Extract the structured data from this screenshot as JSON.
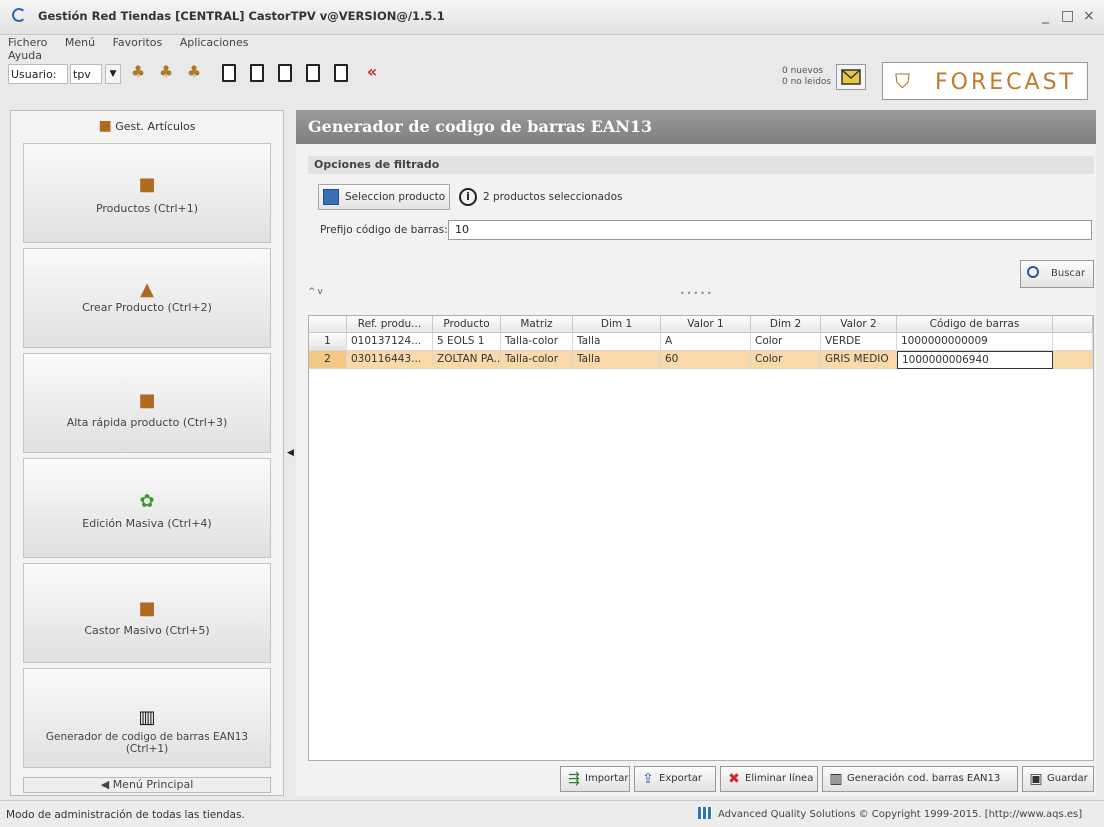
{
  "window": {
    "title": "Gestión Red Tiendas [CENTRAL] CastorTPV v@VERSION@/1.5.1",
    "controls": [
      "_",
      "□",
      "×"
    ]
  },
  "menubar": [
    "Fichero",
    "Menú",
    "Favoritos",
    "Aplicaciones",
    "Ayuda"
  ],
  "toolbar": {
    "user_label": "Usuario:",
    "user_value": "tpv",
    "messages_new": "0 nuevos",
    "messages_unread": "0 no leidos",
    "brand": "FORECAST"
  },
  "left_panel": {
    "title": "Gest. Artículos",
    "buttons": [
      {
        "label": "Productos (Ctrl+1)",
        "icon": "box-icon"
      },
      {
        "label": "Crear Producto (Ctrl+2)",
        "icon": "create-product-icon"
      },
      {
        "label": "Alta rápida producto (Ctrl+3)",
        "icon": "box-icon"
      },
      {
        "label": "Edición Masiva (Ctrl+4)",
        "icon": "gear-icon"
      },
      {
        "label": "Castor Masivo (Ctrl+5)",
        "icon": "box-icon"
      },
      {
        "label": "Generador de codigo de barras EAN13 (Ctrl+1)",
        "icon": "barcode-icon"
      }
    ],
    "main_menu": "◀ Menú Principal"
  },
  "main": {
    "header": "Generador de codigo de barras EAN13",
    "filter_section": "Opciones de filtrado",
    "select_product_button": "Seleccion producto",
    "selected_info": "2 productos seleccionados",
    "prefix_label": "Prefijo código de barras:",
    "prefix_value": "10",
    "search_button": "Buscar",
    "table": {
      "columns": [
        "Ref. produ...",
        "Producto",
        "Matriz",
        "Dim 1",
        "Valor 1",
        "Dim 2",
        "Valor 2",
        "Código de barras"
      ],
      "rows": [
        {
          "num": "1",
          "cells": [
            "010137124...",
            "5 EOLS 1",
            "Talla-color",
            "Talla",
            "A",
            "Color",
            "VERDE",
            "1000000000009"
          ]
        },
        {
          "num": "2",
          "cells": [
            "030116443...",
            "ZOLTAN PA...",
            "Talla-color",
            "Talla",
            "60",
            "Color",
            "GRIS MEDIO",
            "1000000006940"
          ]
        }
      ]
    },
    "actions": {
      "import": "Importar",
      "export": "Exportar",
      "delete_line": "Eliminar línea",
      "generate": "Generación cod. barras EAN13",
      "save": "Guardar"
    }
  },
  "status": {
    "left": "Modo de administración de todas las tiendas.",
    "right": "Advanced Quality Solutions © Copyright 1999-2015. [http://www.aqs.es]"
  }
}
